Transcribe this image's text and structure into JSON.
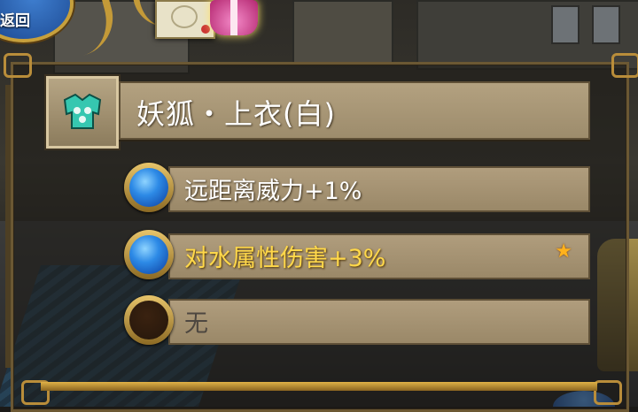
{
  "hud": {
    "back_label": "返回",
    "mail_icon": "mail-icon",
    "gift_icon": "gift-icon"
  },
  "item": {
    "icon": "armor-icon",
    "name": "妖狐・上衣(白)"
  },
  "stats": [
    {
      "text": "远距离威力+1%",
      "orb": "blue",
      "highlight": false,
      "star": false
    },
    {
      "text": "对水属性伤害+3%",
      "orb": "blue",
      "highlight": true,
      "star": true
    },
    {
      "text": "无",
      "orb": "empty",
      "highlight": false,
      "star": false
    }
  ],
  "colors": {
    "highlight_text": "#ffd84a",
    "panel_border": "#6b5833",
    "bar_fill": "#a89676",
    "orb_blue": "#2d8ae6",
    "star": "#ffb21c"
  }
}
